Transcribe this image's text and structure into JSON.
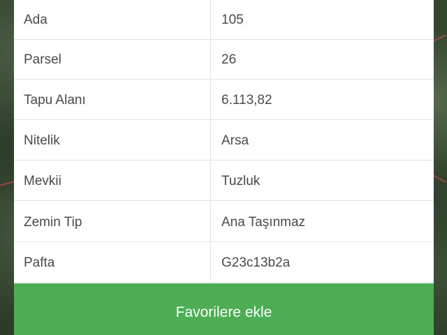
{
  "rows": [
    {
      "label": "Ada",
      "value": "105"
    },
    {
      "label": "Parsel",
      "value": "26"
    },
    {
      "label": "Tapu Alanı",
      "value": "6.113,82"
    },
    {
      "label": "Nitelik",
      "value": "Arsa"
    },
    {
      "label": "Mevkii",
      "value": "Tuzluk"
    },
    {
      "label": "Zemin Tip",
      "value": "Ana Taşınmaz"
    },
    {
      "label": "Pafta",
      "value": "G23c13b2a"
    }
  ],
  "actions": {
    "favorite_label": "Favorilere ekle"
  },
  "colors": {
    "button_green": "#4cad54",
    "text": "#4a4a4a",
    "border": "#e2e2e2"
  }
}
